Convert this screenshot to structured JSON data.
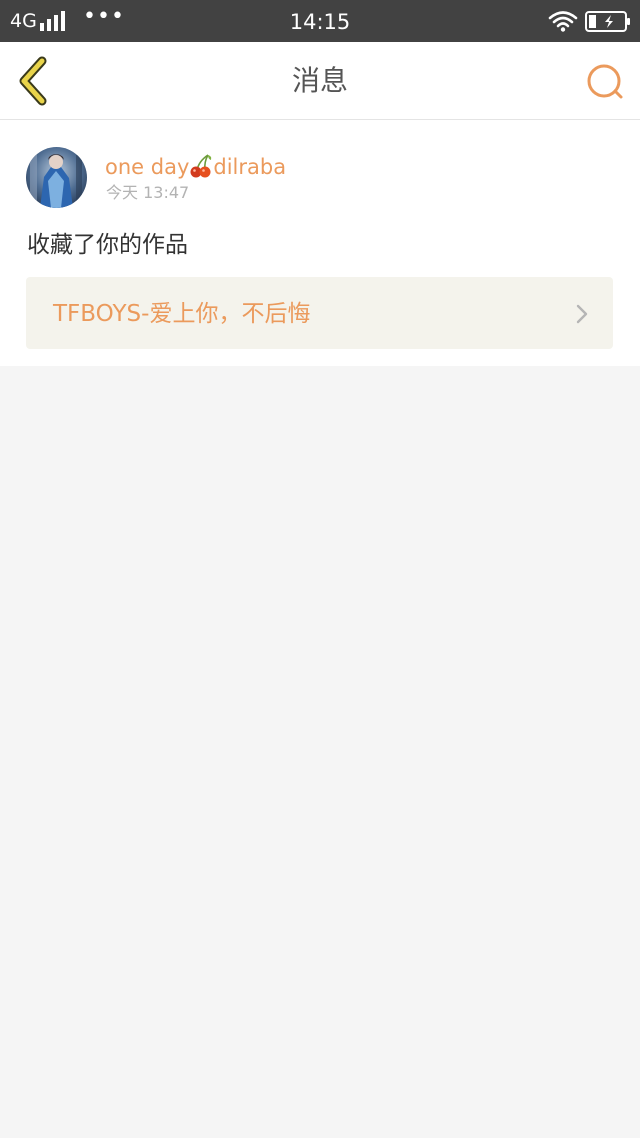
{
  "status_bar": {
    "network": "4G",
    "dots": "•••",
    "time": "14:15"
  },
  "header": {
    "title": "消息",
    "back_icon": "chevron-left-icon",
    "search_icon": "search-icon"
  },
  "message": {
    "username_prefix": "one day",
    "username_suffix": "dilraba",
    "username_emoji": "cherry-icon",
    "timestamp": "今天 13:47",
    "action": "收藏了你的作品",
    "work_title": "TFBOYS-爱上你，不后悔"
  },
  "colors": {
    "status_bar_bg": "#424242",
    "accent_orange": "#eb9a5c",
    "back_icon_yellow": "#e9d44a",
    "link_card_bg": "#f4f3ec",
    "page_bg": "#f5f5f5"
  }
}
